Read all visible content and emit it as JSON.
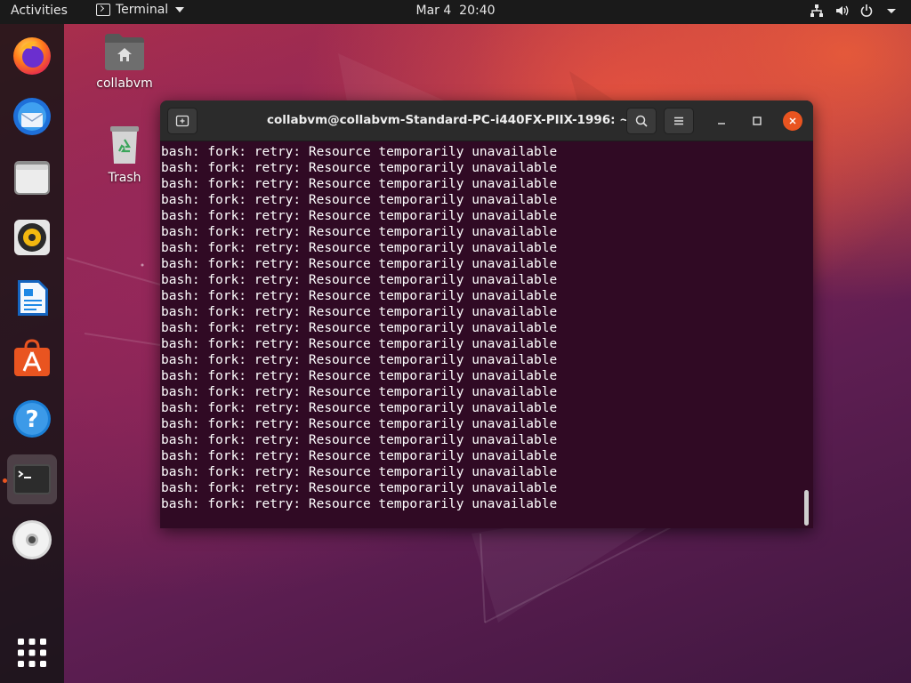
{
  "topbar": {
    "activities_label": "Activities",
    "app_name": "Terminal",
    "clock": "Mar 4  20:40",
    "tray_icons": [
      "network-icon",
      "volume-icon",
      "power-icon",
      "chevron-down-icon"
    ]
  },
  "dock": {
    "items": [
      {
        "name": "firefox",
        "icon": "firefox-icon"
      },
      {
        "name": "thunderbird",
        "icon": "thunderbird-icon"
      },
      {
        "name": "files",
        "icon": "files-icon"
      },
      {
        "name": "rhythmbox",
        "icon": "rhythmbox-icon"
      },
      {
        "name": "libreoffice-writer",
        "icon": "writer-icon"
      },
      {
        "name": "ubuntu-software",
        "icon": "software-icon"
      },
      {
        "name": "help",
        "icon": "help-icon"
      },
      {
        "name": "terminal",
        "icon": "terminal-icon",
        "active": true,
        "running": true
      },
      {
        "name": "dvd",
        "icon": "dvd-icon"
      },
      {
        "name": "show-applications",
        "icon": "app-grid-icon"
      }
    ]
  },
  "desktop": {
    "icons": [
      {
        "label": "collabvm",
        "icon": "home-folder-icon"
      },
      {
        "label": "Trash",
        "icon": "trash-icon"
      }
    ]
  },
  "window": {
    "title": "collabvm@collabvm-Standard-PC-i440FX-PIIX-1996: ~",
    "lines": [
      "bash: fork: retry: Resource temporarily unavailable",
      "bash: fork: retry: Resource temporarily unavailable",
      "bash: fork: retry: Resource temporarily unavailable",
      "bash: fork: retry: Resource temporarily unavailable",
      "bash: fork: retry: Resource temporarily unavailable",
      "bash: fork: retry: Resource temporarily unavailable",
      "bash: fork: retry: Resource temporarily unavailable",
      "bash: fork: retry: Resource temporarily unavailable",
      "bash: fork: retry: Resource temporarily unavailable",
      "bash: fork: retry: Resource temporarily unavailable",
      "bash: fork: retry: Resource temporarily unavailable",
      "bash: fork: retry: Resource temporarily unavailable",
      "bash: fork: retry: Resource temporarily unavailable",
      "bash: fork: retry: Resource temporarily unavailable",
      "bash: fork: retry: Resource temporarily unavailable",
      "bash: fork: retry: Resource temporarily unavailable",
      "bash: fork: retry: Resource temporarily unavailable",
      "bash: fork: retry: Resource temporarily unavailable",
      "bash: fork: retry: Resource temporarily unavailable",
      "bash: fork: retry: Resource temporarily unavailable",
      "bash: fork: retry: Resource temporarily unavailable",
      "bash: fork: retry: Resource temporarily unavailable",
      "bash: fork: retry: Resource temporarily unavailable"
    ]
  },
  "colors": {
    "terminal_bg": "#300a24",
    "accent": "#e95420",
    "topbar_bg": "#1a1a1a"
  }
}
